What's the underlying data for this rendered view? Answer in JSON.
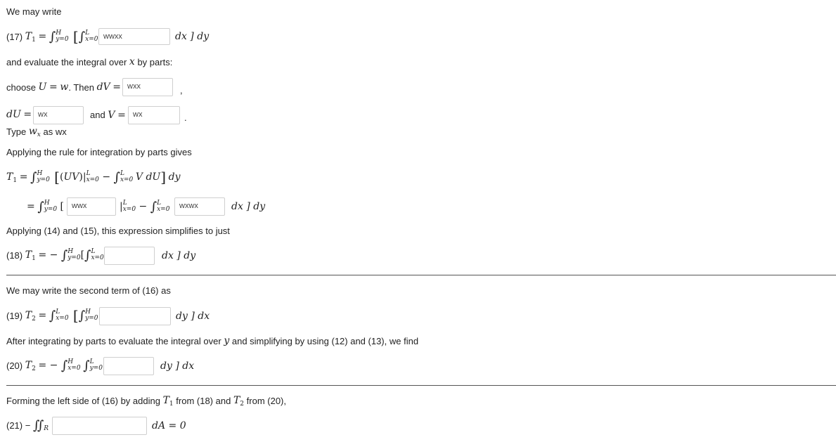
{
  "text": {
    "we_may_write": "We may write",
    "eq17_label": "(17)",
    "and_evaluate_pre": "and evaluate the integral over",
    "and_evaluate_var": "x",
    "and_evaluate_post": "by parts:",
    "choose": "choose",
    "then": ". Then",
    "and": "and",
    "type_pre": "Type",
    "type_post": "as wx",
    "applying_rule": "Applying the rule for integration by parts gives",
    "applying_14_15": "Applying (14) and (15), this expression simplifies to just",
    "eq18_label": "(18)",
    "second_term": "We may write the second term of (16) as",
    "eq19_label": "(19)",
    "after_integrating_pre": "After integrating by parts to evaluate the integral over",
    "after_integrating_var": "y",
    "after_integrating_post": "and simplifying by using (12) and (13), we find",
    "eq20_label": "(20)",
    "forming_pre": "Forming the left side of (16) by adding",
    "forming_from18": "from (18) and",
    "forming_from20": "from (20),",
    "eq21_label": "(21) −"
  },
  "inputs": {
    "eq17_integrand": "wwxx",
    "dV": "wxx",
    "dU": "wx",
    "V": "wx",
    "uv_term": "wwx",
    "vdu_term": "wxwx",
    "eq18_integrand": "",
    "eq19_integrand": "",
    "eq20_integrand": "",
    "eq21_integrand": ""
  }
}
